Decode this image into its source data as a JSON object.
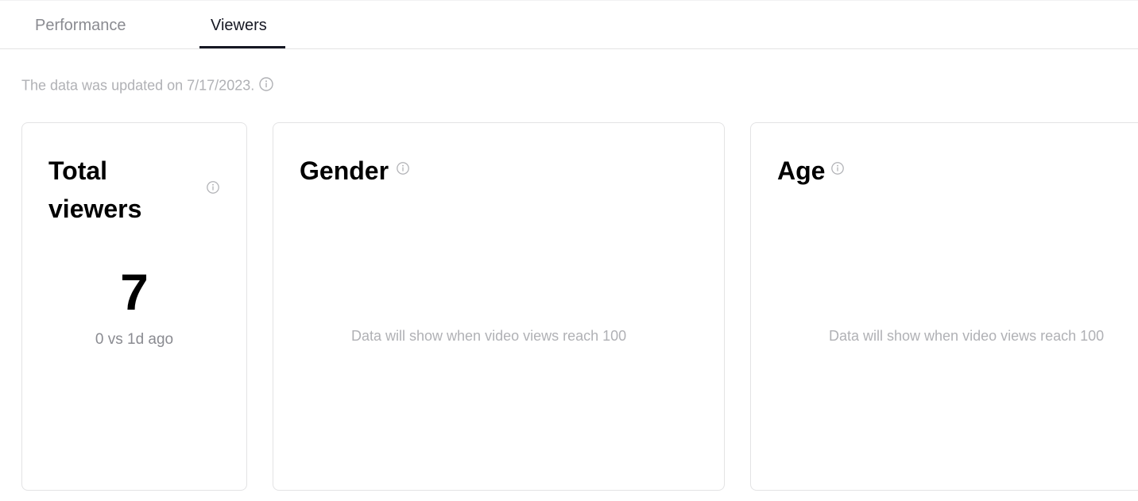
{
  "tabs": [
    {
      "label": "Performance",
      "active": false
    },
    {
      "label": "Viewers",
      "active": true
    }
  ],
  "updated_text": "The data was updated on 7/17/2023.",
  "cards": {
    "total_viewers": {
      "title": "Total viewers",
      "value": "7",
      "comparison": "0 vs 1d ago"
    },
    "gender": {
      "title": "Gender",
      "empty_message": "Data will show when video views reach 100"
    },
    "age": {
      "title": "Age",
      "empty_message": "Data will show when video views reach 100"
    }
  },
  "icons": {
    "info": "info-circle-icon"
  },
  "colors": {
    "text_primary": "#161823",
    "text_muted": "#8a8b91",
    "text_faint": "#b0b1b5",
    "border": "#e3e3e4"
  }
}
